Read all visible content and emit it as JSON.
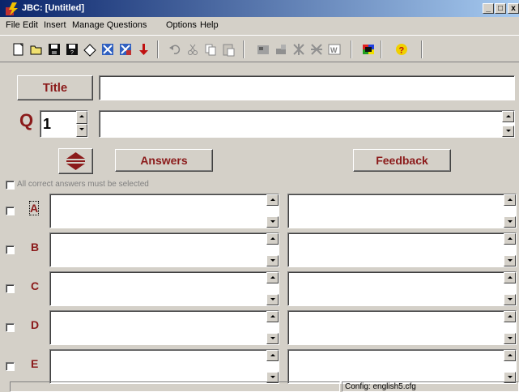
{
  "window": {
    "title": "JBC: [Untitled]"
  },
  "menu": [
    "File",
    "Edit",
    "Insert",
    "Manage Questions",
    "Options",
    "Help"
  ],
  "toolbar_icons": [
    "new-icon",
    "open-icon",
    "save-icon",
    "save-as-icon",
    "eraser-icon",
    "add-icon",
    "remove-icon",
    "arrow-down-icon",
    "undo-icon",
    "cut-icon",
    "copy-icon",
    "paste-icon",
    "web-page-icon",
    "export-icon",
    "settings-a-icon",
    "settings-b-icon",
    "tag-icon",
    "colors-icon",
    "help-icon"
  ],
  "title_button": "Title",
  "title_value": "",
  "q_label": "Q",
  "q_number": "1",
  "question_text": "",
  "answers_button": "Answers",
  "feedback_button": "Feedback",
  "all_correct_label": "All correct answers must be selected",
  "answers": [
    {
      "letter": "A",
      "answer": "",
      "feedback": "",
      "checked": false
    },
    {
      "letter": "B",
      "answer": "",
      "feedback": "",
      "checked": false
    },
    {
      "letter": "C",
      "answer": "",
      "feedback": "",
      "checked": false
    },
    {
      "letter": "D",
      "answer": "",
      "feedback": "",
      "checked": false
    },
    {
      "letter": "E",
      "answer": "",
      "feedback": "",
      "checked": false
    }
  ],
  "status": {
    "config": "Config: english5.cfg"
  },
  "colors": {
    "title_gradient_start": "#0a246a",
    "title_gradient_end": "#a6caf0",
    "accent": "#8b1a1a",
    "face": "#d4d0c8"
  }
}
